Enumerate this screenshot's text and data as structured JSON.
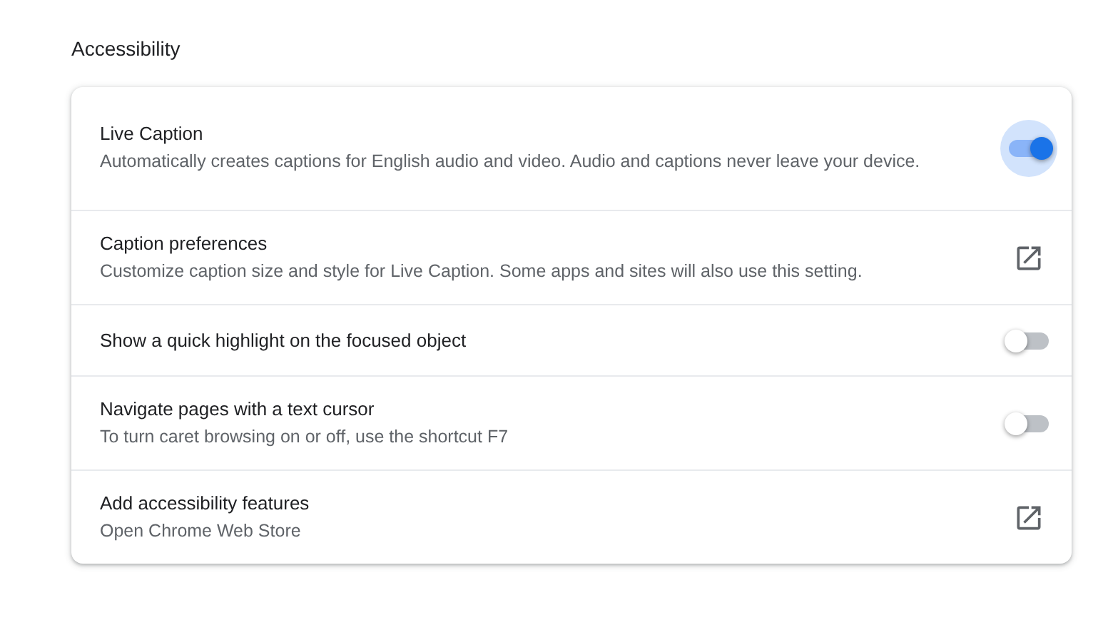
{
  "section_title": "Accessibility",
  "rows": [
    {
      "kind": "toggle",
      "title": "Live Caption",
      "description": "Automatically creates captions for English audio and video. Audio and captions never leave your device.",
      "on": true,
      "focused": true
    },
    {
      "kind": "link",
      "title": "Caption preferences",
      "description": "Customize caption size and style for Live Caption. Some apps and sites will also use this setting."
    },
    {
      "kind": "toggle",
      "title": "Show a quick highlight on the focused object",
      "on": false,
      "focused": false
    },
    {
      "kind": "toggle",
      "title": "Navigate pages with a text cursor",
      "description": "To turn caret browsing on or off, use the shortcut F7",
      "on": false,
      "focused": false
    },
    {
      "kind": "link",
      "title": "Add accessibility features",
      "description": "Open Chrome Web Store"
    }
  ]
}
